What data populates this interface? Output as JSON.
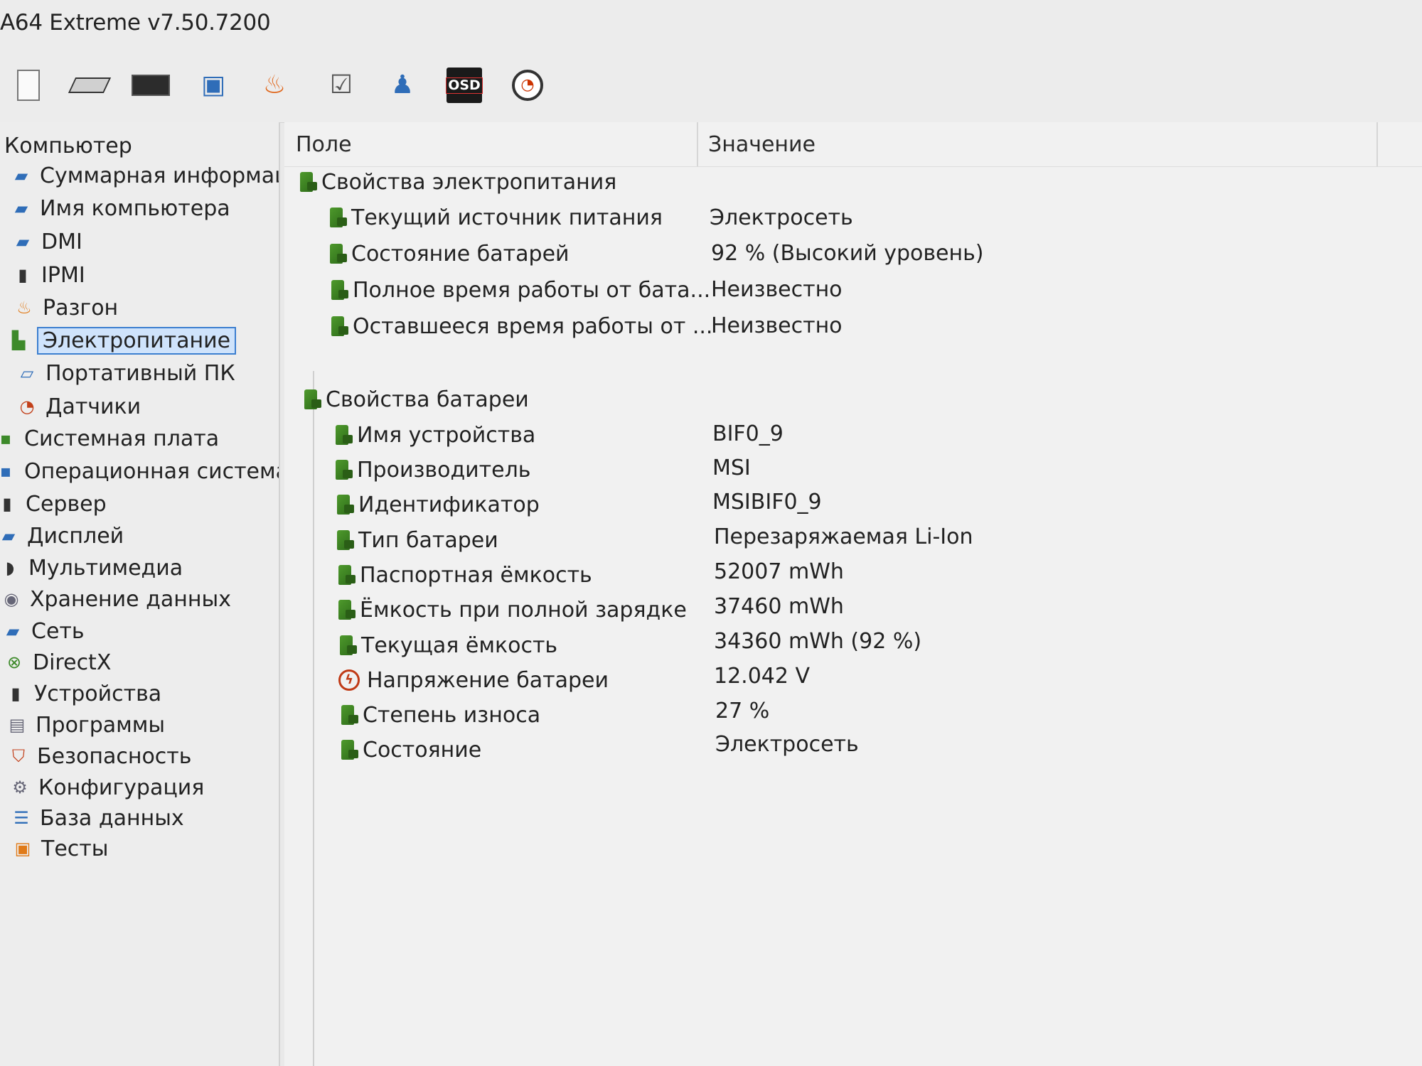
{
  "window": {
    "title": "A64 Extreme v7.50.7200"
  },
  "toolbar": {
    "buttons": [
      {
        "name": "report-icon"
      },
      {
        "name": "motherboard-icon"
      },
      {
        "name": "memory-icon"
      },
      {
        "name": "computer-icon"
      },
      {
        "name": "overclock-flame-icon"
      },
      {
        "name": "benchmark-icon"
      },
      {
        "name": "user-icon"
      },
      {
        "name": "osd-icon",
        "label": "OSD"
      },
      {
        "name": "sensor-gauge-icon"
      }
    ]
  },
  "sidebar": {
    "root": "Компьютер",
    "items": [
      {
        "label": "Суммарная информаци",
        "icon": "monitor-icon",
        "indent": true
      },
      {
        "label": "Имя компьютера",
        "icon": "monitor-icon",
        "indent": true
      },
      {
        "label": "DMI",
        "icon": "monitor-icon",
        "indent": true
      },
      {
        "label": "IPMI",
        "icon": "server-icon",
        "indent": true
      },
      {
        "label": "Разгон",
        "icon": "flame-icon",
        "indent": true
      },
      {
        "label": "Электропитание",
        "icon": "power-plug-icon",
        "indent": true,
        "selected": true
      },
      {
        "label": "Портативный ПК",
        "icon": "laptop-icon",
        "indent": true
      },
      {
        "label": "Датчики",
        "icon": "gauge-icon",
        "indent": true
      },
      {
        "label": "Системная плата",
        "icon": "motherboard-icon"
      },
      {
        "label": "Операционная система",
        "icon": "windows-icon"
      },
      {
        "label": "Сервер",
        "icon": "server-icon"
      },
      {
        "label": "Дисплей",
        "icon": "display-icon"
      },
      {
        "label": "Мультимедиа",
        "icon": "speaker-icon"
      },
      {
        "label": "Хранение данных",
        "icon": "disk-icon"
      },
      {
        "label": "Сеть",
        "icon": "network-icon"
      },
      {
        "label": "DirectX",
        "icon": "xbox-icon"
      },
      {
        "label": "Устройства",
        "icon": "devices-icon"
      },
      {
        "label": "Программы",
        "icon": "programs-icon"
      },
      {
        "label": "Безопасность",
        "icon": "shield-icon"
      },
      {
        "label": "Конфигурация",
        "icon": "config-icon"
      },
      {
        "label": "База данных",
        "icon": "database-icon"
      },
      {
        "label": "Тесты",
        "icon": "benchmark-icon"
      }
    ]
  },
  "table": {
    "col_field": "Поле",
    "col_value": "Значение",
    "groups": [
      {
        "title": "Свойства электропитания",
        "rows": [
          {
            "field": "Текущий источник питания",
            "value": "Электросеть"
          },
          {
            "field": "Состояние батарей",
            "value": "92 % (Высокий уровень)"
          },
          {
            "field": "Полное время работы от бата...",
            "value": "Неизвестно"
          },
          {
            "field": "Оставшееся время работы от ...",
            "value": "Неизвестно"
          }
        ]
      },
      {
        "title": "Свойства батареи",
        "rows": [
          {
            "field": "Имя устройства",
            "value": "BIF0_9"
          },
          {
            "field": "Производитель",
            "value": "MSI"
          },
          {
            "field": "Идентификатор",
            "value": "MSIBIF0_9"
          },
          {
            "field": "Тип батареи",
            "value": "Перезаряжаемая Li-Ion"
          },
          {
            "field": "Паспортная ёмкость",
            "value": "52007 mWh"
          },
          {
            "field": "Ёмкость при полной зарядке",
            "value": "37460 mWh"
          },
          {
            "field": "Текущая ёмкость",
            "value": "34360 mWh  (92 %)"
          },
          {
            "field": "Напряжение батареи",
            "value": "12.042 V",
            "icon": "voltage-icon"
          },
          {
            "field": "Степень износа",
            "value": "27 %"
          },
          {
            "field": "Состояние",
            "value": "Электросеть"
          }
        ]
      }
    ]
  }
}
